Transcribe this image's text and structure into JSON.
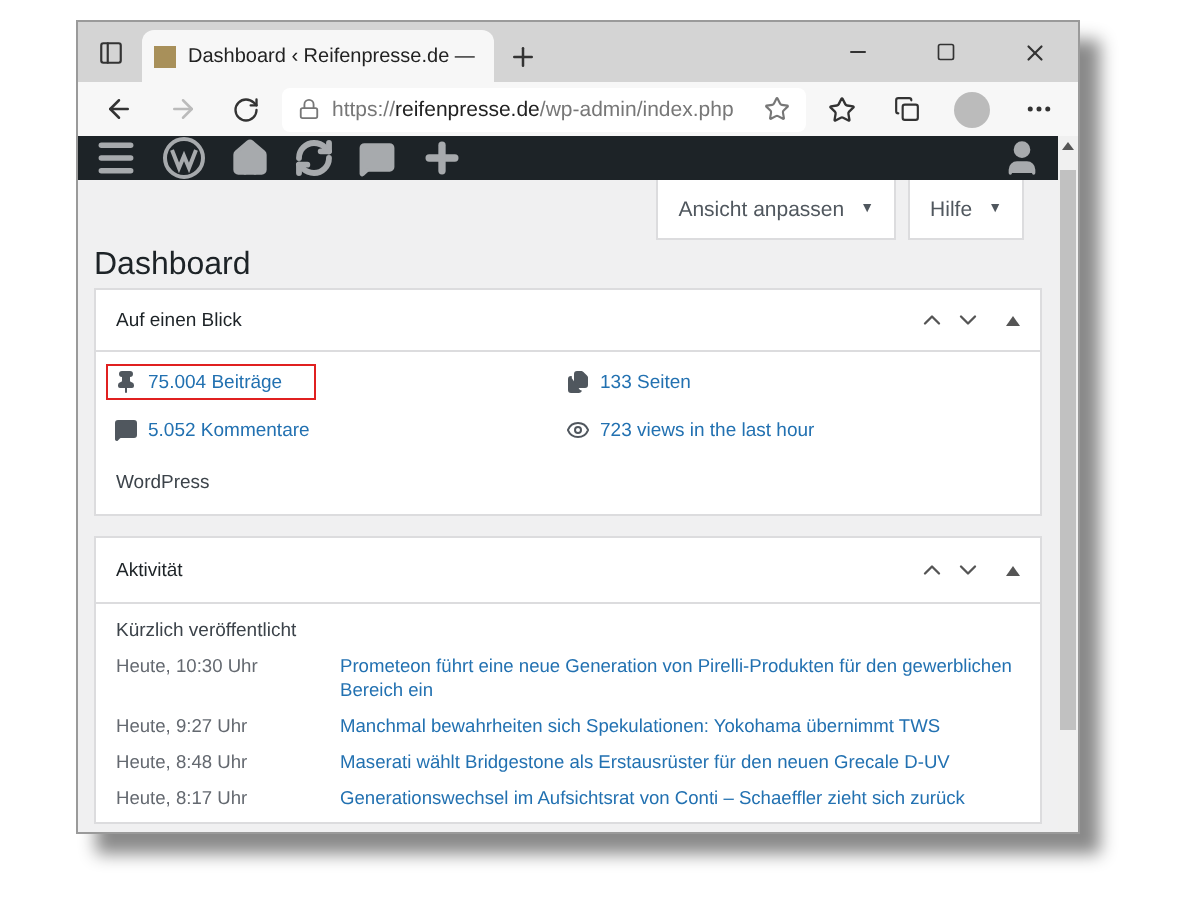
{
  "browser": {
    "tab_title": "Dashboard ‹ Reifenpresse.de —",
    "url": {
      "scheme": "https://",
      "host": "reifenpresse.de",
      "path": "/wp-admin/index.php"
    }
  },
  "screen_options": [
    {
      "label": "Ansicht anpassen",
      "caret": "▼"
    },
    {
      "label": "Hilfe",
      "caret": "▼"
    }
  ],
  "page_title": "Dashboard",
  "at_a_glance": {
    "title": "Auf einen Blick",
    "stats": [
      {
        "kind": "posts",
        "label": "75.004 Beiträge",
        "highlighted": true
      },
      {
        "kind": "pages",
        "label": "133 Seiten",
        "highlighted": false
      },
      {
        "kind": "comments",
        "label": "5.052 Kommentare",
        "highlighted": false
      },
      {
        "kind": "views",
        "label": "723 views in the last hour",
        "highlighted": false
      }
    ],
    "footer": "WordPress"
  },
  "activity": {
    "title": "Aktivität",
    "subtitle": "Kürzlich veröffentlicht",
    "rows": [
      {
        "time": "Heute, 10:30 Uhr",
        "title": "Prometeon führt eine neue Generation von Pirelli-Produkten für den gewerblichen Bereich ein"
      },
      {
        "time": "Heute, 9:27 Uhr",
        "title": "Manchmal bewahrheiten sich Spekulationen: Yokohama übernimmt TWS"
      },
      {
        "time": "Heute, 8:48 Uhr",
        "title": "Maserati wählt Bridgestone als Erstausrüster für den neuen Grecale D-UV"
      },
      {
        "time": "Heute, 8:17 Uhr",
        "title": "Generationswechsel im Aufsichtsrat von Conti – Schaeffler zieht sich zurück"
      }
    ]
  }
}
